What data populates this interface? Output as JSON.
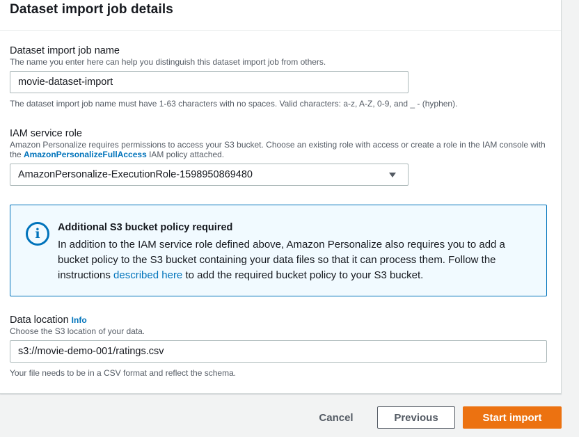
{
  "panel": {
    "title": "Dataset import job details"
  },
  "job_name": {
    "label": "Dataset import job name",
    "description": "The name you enter here can help you distinguish this dataset import job from others.",
    "value": "movie-dataset-import",
    "constraint": "The dataset import job name must have 1-63 characters with no spaces. Valid characters: a-z, A-Z, 0-9, and _ - (hyphen)."
  },
  "iam_role": {
    "label": "IAM service role",
    "description_part1": "Amazon Personalize requires permissions to access your S3 bucket. Choose an existing role with access or create a role in the IAM console with the ",
    "policy_link": "AmazonPersonalizeFullAccess",
    "description_part2": " IAM policy attached.",
    "selected": "AmazonPersonalize-ExecutionRole-1598950869480"
  },
  "alert": {
    "title": "Additional S3 bucket policy required",
    "body_part1": "In addition to the IAM service role defined above, Amazon Personalize also requires you to add a bucket policy to the S3 bucket containing your data files so that it can process them. Follow the instructions ",
    "link": "described here",
    "body_part2": " to add the required bucket policy to your S3 bucket."
  },
  "data_location": {
    "label": "Data location",
    "info_link": "Info",
    "description": "Choose the S3 location of your data.",
    "value": "s3://movie-demo-001/ratings.csv",
    "constraint": "Your file needs to be in a CSV format and reflect the schema."
  },
  "footer": {
    "cancel": "Cancel",
    "previous": "Previous",
    "start": "Start import"
  },
  "colors": {
    "primary_button": "#ec7211",
    "link": "#0073bb",
    "info_background": "#f1faff"
  },
  "icons": {
    "alert": "info-icon",
    "select": "caret-down-icon"
  }
}
